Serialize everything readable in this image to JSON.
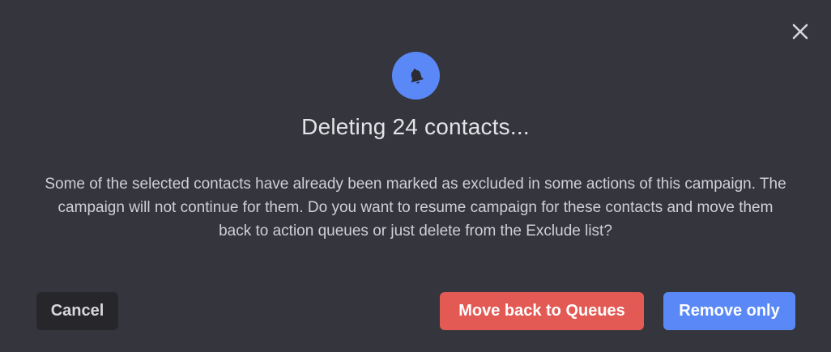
{
  "dialog": {
    "title": "Deleting 24 contacts...",
    "message": "Some of the selected contacts have already been marked as excluded in some actions of this campaign. The campaign will not continue for them. Do you want to resume campaign for these contacts and move them back to action queues or just delete from the Exclude list?",
    "header_icon": "bell-icon",
    "close_icon": "close-icon"
  },
  "buttons": {
    "cancel_label": "Cancel",
    "move_back_label": "Move back to Queues",
    "remove_only_label": "Remove only"
  },
  "colors": {
    "background": "#35353d",
    "accent_blue": "#5a89f7",
    "danger_red": "#e35a55",
    "cancel_bg": "#26262b"
  }
}
